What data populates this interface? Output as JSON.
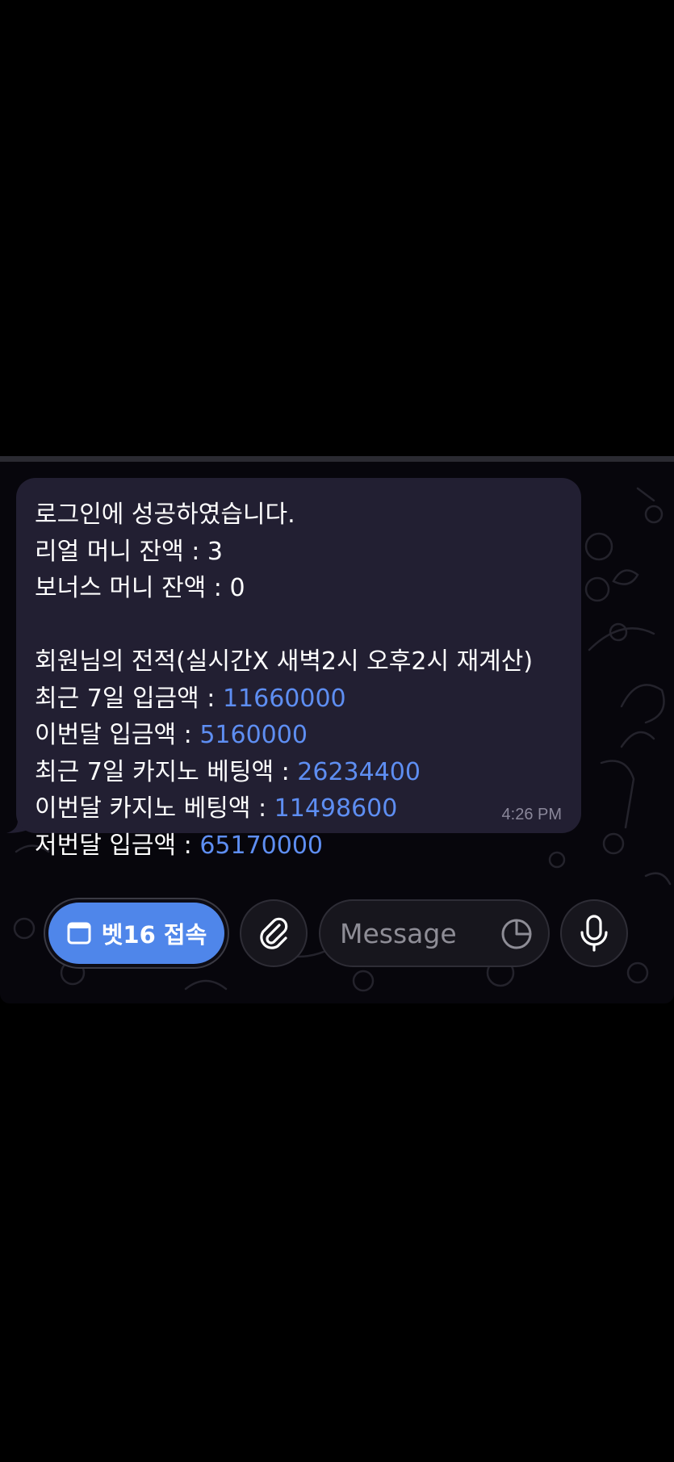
{
  "message": {
    "lines": [
      {
        "text": "로그인에 성공하였습니다.",
        "value": ""
      },
      {
        "text": "리얼 머니 잔액 : 3",
        "value": ""
      },
      {
        "text": "보너스 머니 잔액 : 0",
        "value": ""
      },
      {
        "text": "",
        "value": ""
      },
      {
        "text": "회원님의 전적(실시간X 새벽2시 오후2시 재계산)",
        "value": ""
      },
      {
        "text": "최근 7일 입금액 : ",
        "value": "11660000"
      },
      {
        "text": "이번달 입금액 : ",
        "value": "5160000"
      },
      {
        "text": "최근 7일 카지노 베팅액 : ",
        "value": "26234400"
      },
      {
        "text": "이번달 카지노 베팅액 : ",
        "value": "11498600"
      },
      {
        "text": "저번달 입금액 : ",
        "value": "65170000"
      }
    ],
    "time": "4:26 PM"
  },
  "input_bar": {
    "bet_button_label": "벳16 접속",
    "bet_button_icon": "window-icon",
    "attach_icon": "paperclip-icon",
    "message_placeholder": "Message",
    "message_value": "",
    "sticker_icon": "sticker-icon",
    "mic_icon": "microphone-icon"
  },
  "colors": {
    "background": "#000000",
    "bubble": "#221f32",
    "link_number": "#5e8ef2",
    "bet_button": "#4f86ea",
    "timestamp": "#8a879a"
  }
}
